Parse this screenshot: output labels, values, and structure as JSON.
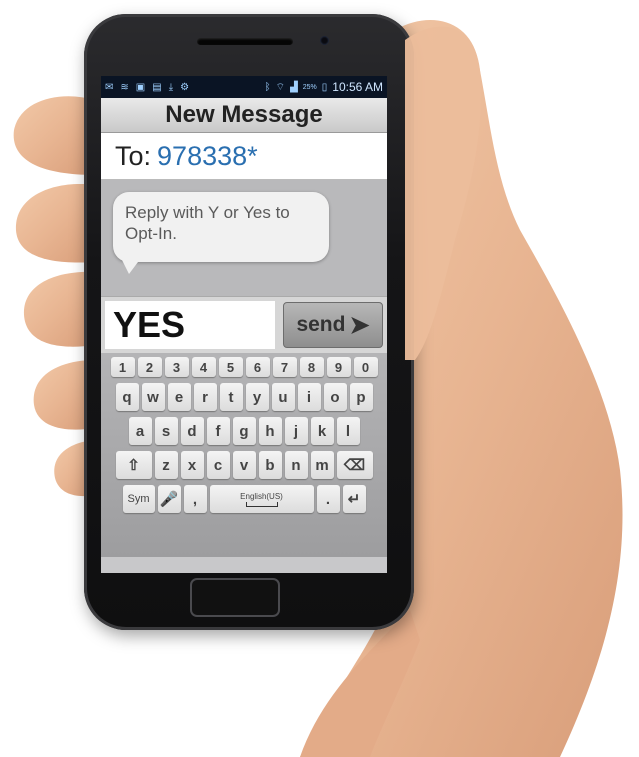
{
  "status_bar": {
    "left_icons": [
      "notification-icon",
      "wifi-icon",
      "mail-icon",
      "image-icon",
      "download-icon",
      "settings-icon"
    ],
    "right_icons": [
      "bluetooth-icon",
      "wifi-signal-icon",
      "cell-signal-icon"
    ],
    "battery": "25%",
    "time": "10:56 AM"
  },
  "header": {
    "title": "New Message"
  },
  "recipient": {
    "label": "To:",
    "number": "978338*"
  },
  "conversation": {
    "incoming_message": "Reply with Y or Yes to Opt-In."
  },
  "compose": {
    "text": "YES",
    "send_label": "send",
    "send_icon": "arrow-right-icon"
  },
  "keyboard": {
    "digits": [
      "1",
      "2",
      "3",
      "4",
      "5",
      "6",
      "7",
      "8",
      "9",
      "0"
    ],
    "row1": [
      "q",
      "w",
      "e",
      "r",
      "t",
      "y",
      "u",
      "i",
      "o",
      "p"
    ],
    "row2": [
      "a",
      "s",
      "d",
      "f",
      "g",
      "h",
      "j",
      "k",
      "l"
    ],
    "row3": [
      "z",
      "x",
      "c",
      "v",
      "b",
      "n",
      "m"
    ],
    "shift_glyph": "⇧",
    "backspace_glyph": "⌫",
    "sym_label": "Sym",
    "mic_glyph": "🎤",
    "comma_label": ",",
    "space_label": "English(US)",
    "period_label": ".",
    "enter_glyph": "↵"
  },
  "colors": {
    "recipient_number": "#2a6fb0",
    "status_bar_bg": "#0a1424"
  }
}
